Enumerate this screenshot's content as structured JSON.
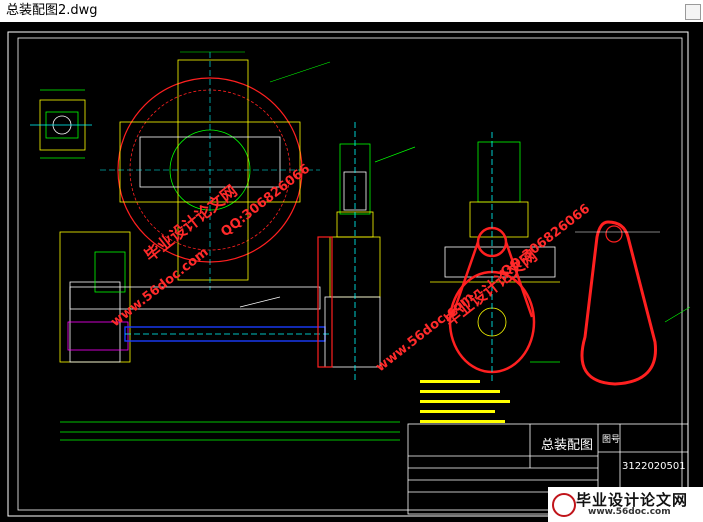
{
  "window": {
    "title": "总装配图2.dwg"
  },
  "drawing": {
    "title_block": {
      "drawing_title": "总装配图",
      "drawing_number": "3122020501",
      "sheet_label": "图号"
    },
    "colors": {
      "background": "#000000",
      "frame": "#ffffff",
      "green": "#00ff00",
      "yellow": "#ffff00",
      "red": "#ff2020",
      "blue": "#1a3cff",
      "cyan": "#00ffff",
      "magenta": "#ff00ff"
    }
  },
  "watermarks": {
    "site_cn": "毕业设计论文网",
    "site_url": "www.56doc.com",
    "qq": "QQ:306826066"
  },
  "footer_banner": {
    "title": "毕业设计论文网",
    "url": "www.56doc.com"
  }
}
